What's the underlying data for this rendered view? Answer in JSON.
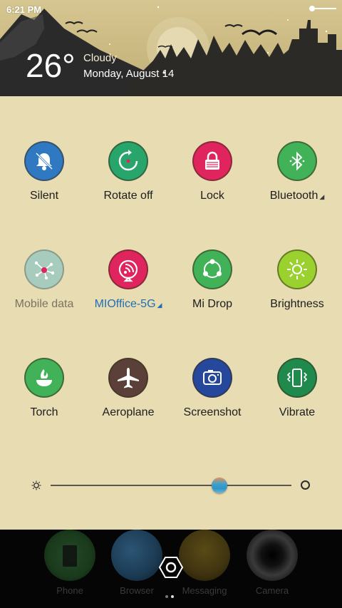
{
  "status": {
    "time": "6:21 PM"
  },
  "weather": {
    "temperature": "26°",
    "condition": "Cloudy",
    "date": "Monday, August 14"
  },
  "tiles": [
    {
      "label": "Silent",
      "icon": "bell-muted-icon",
      "color": "#2f79c3",
      "state": "on"
    },
    {
      "label": "Rotate off",
      "icon": "rotate-icon",
      "color": "#27a56a",
      "state": "on"
    },
    {
      "label": "Lock",
      "icon": "lock-icon",
      "color": "#e0245e",
      "state": "on"
    },
    {
      "label": "Bluetooth",
      "icon": "bluetooth-icon",
      "color": "#41b257",
      "state": "on",
      "has_menu": true
    },
    {
      "label": "Mobile data",
      "icon": "mobile-data-icon",
      "color": "#a7cbbd",
      "state": "off"
    },
    {
      "label": "MIOffice-5G",
      "icon": "wifi-icon",
      "color": "#e0245e",
      "state": "on",
      "has_menu": true
    },
    {
      "label": "Mi Drop",
      "icon": "mi-drop-icon",
      "color": "#41b257",
      "state": "on"
    },
    {
      "label": "Brightness",
      "icon": "brightness-icon",
      "color": "#9bd12f",
      "state": "on"
    },
    {
      "label": "Torch",
      "icon": "torch-icon",
      "color": "#41b257",
      "state": "on"
    },
    {
      "label": "Aeroplane",
      "icon": "aeroplane-icon",
      "color": "#5a4038",
      "state": "on"
    },
    {
      "label": "Screenshot",
      "icon": "screenshot-icon",
      "color": "#25479c",
      "state": "on"
    },
    {
      "label": "Vibrate",
      "icon": "vibrate-icon",
      "color": "#1f8a4c",
      "state": "on"
    }
  ],
  "brightness": {
    "level": 0.7
  },
  "dock": {
    "apps": [
      {
        "label": "Phone",
        "icon": "phone-app-icon"
      },
      {
        "label": "Browser",
        "icon": "browser-app-icon"
      },
      {
        "label": "Messaging",
        "icon": "messaging-app-icon"
      },
      {
        "label": "Camera",
        "icon": "camera-app-icon"
      }
    ],
    "page_indicator": {
      "pages": 2,
      "current": 2
    }
  }
}
